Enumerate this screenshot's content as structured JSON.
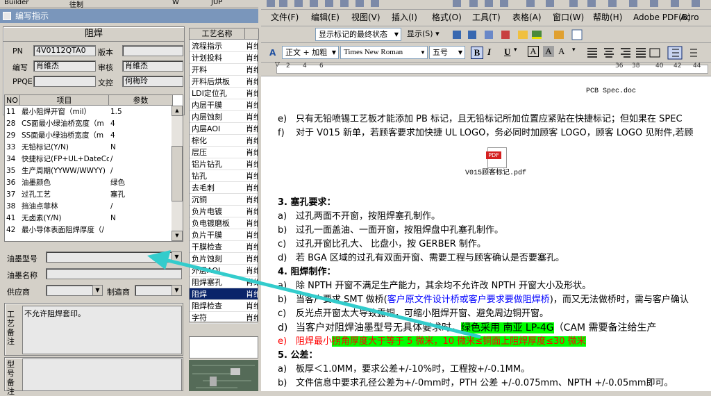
{
  "left_app": {
    "top_strip": [
      "Builder",
      "往制",
      "W",
      "JUP"
    ],
    "window_title": "编写指示",
    "section_title": "阻焊",
    "form": {
      "pn_label": "PN",
      "pn_value": "4V0112QTA0",
      "version_label": "版本",
      "version_value": "",
      "author_label": "编写",
      "author_value": "肖維杰",
      "review_label": "审核",
      "review_value": "肖維杰",
      "ppqe_label": "PPQE",
      "ppqe_value": "",
      "control_label": "文控",
      "control_value": "何梅玲"
    },
    "grid_headers": [
      "NO",
      "项目",
      "参数"
    ],
    "grid_rows": [
      {
        "no": "11",
        "item": "最小阻焊开窗（mil）",
        "param": "1.5"
      },
      {
        "no": "28",
        "item": "CS面最小绿油桥宽度（m",
        "param": "4"
      },
      {
        "no": "29",
        "item": "SS面最小绿油桥宽度（m",
        "param": "4"
      },
      {
        "no": "33",
        "item": "无铅标记(Y/N)",
        "param": "N"
      },
      {
        "no": "34",
        "item": "快捷标记(FP+UL+DateCo",
        "param": "/"
      },
      {
        "no": "35",
        "item": "生产周期(YYWW/WWYY)",
        "param": "/"
      },
      {
        "no": "36",
        "item": "油墨颜色",
        "param": "绿色"
      },
      {
        "no": "37",
        "item": "过孔工艺",
        "param": "塞孔"
      },
      {
        "no": "38",
        "item": "挡油点菲林",
        "param": "/"
      },
      {
        "no": "41",
        "item": "无卤素(Y/N)",
        "param": "N"
      },
      {
        "no": "42",
        "item": "最小导体表面阻焊厚度（/",
        "param": ""
      }
    ],
    "ink_model_label": "油墨型号",
    "ink_name_label": "油墨名称",
    "supplier_label": "供应商",
    "manufacturer_label": "制造商",
    "process_note_label": "工艺备注",
    "process_note_text": "不允许阻焊套印。",
    "model_note_label": "型号备注",
    "process_list_header": "工艺名称",
    "process_list": [
      {
        "name": "流程指示",
        "col": "肖维"
      },
      {
        "name": "计划投料",
        "col": "肖维"
      },
      {
        "name": "开料",
        "col": "肖维"
      },
      {
        "name": "开料后烘板",
        "col": "肖维"
      },
      {
        "name": "LDI定位孔",
        "col": "肖维"
      },
      {
        "name": "内层干膜",
        "col": "肖维"
      },
      {
        "name": "内层蚀刻",
        "col": "肖维"
      },
      {
        "name": "内层AOI",
        "col": "肖维"
      },
      {
        "name": "棕化",
        "col": "肖维"
      },
      {
        "name": "层压",
        "col": "肖维"
      },
      {
        "name": "铝片钻孔",
        "col": "肖维"
      },
      {
        "name": "钻孔",
        "col": "肖维"
      },
      {
        "name": "去毛刺",
        "col": "肖维"
      },
      {
        "name": "沉铜",
        "col": "肖维"
      },
      {
        "name": "负片电镀",
        "col": "肖维"
      },
      {
        "name": "负电镀磨板",
        "col": "肖维"
      },
      {
        "name": "负片干膜",
        "col": "肖维"
      },
      {
        "name": "干膜检查",
        "col": "肖维"
      },
      {
        "name": "负片蚀刻",
        "col": "肖维"
      },
      {
        "name": "外层AOI",
        "col": "肖维"
      },
      {
        "name": "阻焊塞孔",
        "col": "肖维"
      },
      {
        "name": "阻焊",
        "col": "肖维"
      },
      {
        "name": "阻焊检查",
        "col": "肖维"
      },
      {
        "name": "字符",
        "col": "肖维"
      }
    ],
    "selected_process_index": 21
  },
  "word": {
    "menu": [
      "文件(F)",
      "编辑(E)",
      "视图(V)",
      "插入(I)",
      "格式(O)",
      "工具(T)",
      "表格(A)",
      "窗口(W)",
      "帮助(H)",
      "Adobe PDF(B)",
      "Acro"
    ],
    "markup_show": "显示标记的最终状态",
    "show_label": "显示(S)",
    "style": "正文 + 加粗",
    "font": "Times New Roman",
    "size": "五号",
    "ruler_ticks": [
      "2",
      "4",
      "6",
      "36",
      "38",
      "40",
      "42",
      "44"
    ],
    "doc": {
      "top_file_caption": "PCB Spec.doc",
      "line_e": {
        "n": "e)",
        "t": "只有无铅喷锡工艺板才能添加 PB 标记，且无铅标记所加位置应紧贴在快捷标记；但如果在 SPEC"
      },
      "line_f": {
        "n": "f)",
        "t": "对于 V015 新单，若顾客要求加快捷 UL LOGO，务必同时加顾客 LOGO，顾客 LOGO 见附件,若顾"
      },
      "pdf_caption": "V015顾客标记.pdf",
      "pdf_tag": "PDF",
      "sec3": "3.   塞孔要求：",
      "s3": [
        {
          "n": "a)",
          "t": "过孔两面不开窗，按阻焊塞孔制作。"
        },
        {
          "n": "b)",
          "t": "过孔一面盖油、一面开窗，按阻焊盘中孔塞孔制作。"
        },
        {
          "n": "c)",
          "t": "过孔开窗比孔大、 比盘小，按 GERBER 制作。"
        },
        {
          "n": "d)",
          "t": "若 BGA 区域的过孔有双面开窗、需要工程与顾客确认是否要塞孔。"
        }
      ],
      "sec4": "4.   阻焊制作：",
      "s4a": {
        "n": "a)",
        "t": "除 NPTH 开窗不满足生产能力，其余均不允许改 NPTH 开窗大小及形状。"
      },
      "s4b": {
        "n": "b)",
        "t1": "当客户要求 SMT 做桥(",
        "t2": "客户原文件设计桥或客户要求要做阻焊桥",
        "t3": ")，而又无法做桥时，需与客户确认"
      },
      "s4c": {
        "n": "c)",
        "t": "反光点开窗太大导致露铜，可缩小阻焊开窗、避免周边铜开窗。"
      },
      "s4d": {
        "n": "d)",
        "t1": "当客户对阻焊油墨型号无具体要求时，",
        "t2": "绿色采用  南亚 LP-4G",
        "t3": "（CAM 需要备注给生产"
      },
      "s4e": {
        "n": "e)",
        "t1": "阻焊最小",
        "t2": "拐角厚度大于等于 5 微米，10 微米≤铜面上阻焊厚度≤30 微米"
      },
      "sec5": "5.   公差：",
      "s5": [
        {
          "n": "a)",
          "t": "板厚＜1.0MM，要求公差+/-10%时，工程按+/-0.1MM。"
        },
        {
          "n": "b)",
          "t": "文件信息中要求孔径公差为+/-0mm时，PTH 公差  +/-0.075mm、NPTH +/-0.05mm即可。"
        }
      ]
    }
  },
  "colors": {
    "arrow": "#33cccc",
    "highlight": "#00ff00",
    "selection": "#0a246a",
    "titlebar": "#7a96bb"
  }
}
